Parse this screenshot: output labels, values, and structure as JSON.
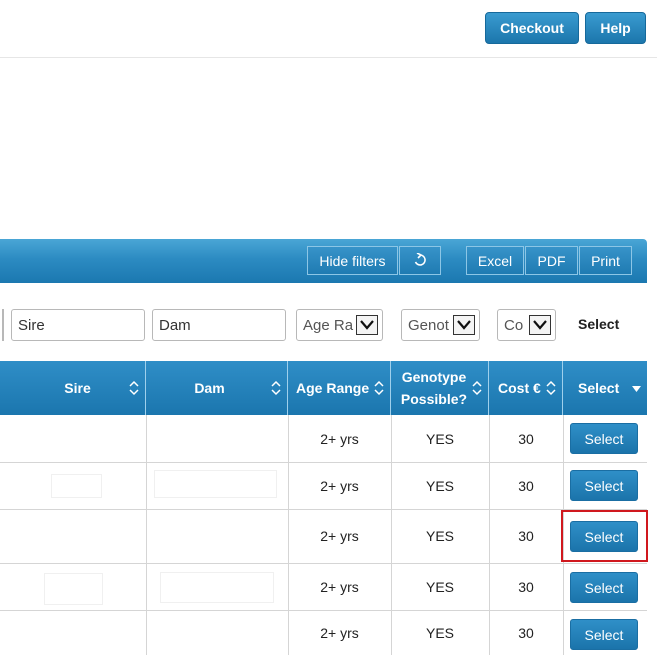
{
  "header": {
    "checkout_label": "Checkout",
    "help_label": "Help"
  },
  "toolbar": {
    "hide_filters_label": "Hide filters",
    "refresh_icon": "refresh-icon",
    "excel_label": "Excel",
    "pdf_label": "PDF",
    "print_label": "Print"
  },
  "filters": {
    "sire_value": "Sire",
    "dam_value": "Dam",
    "age_range_text": "Age Ra",
    "genotype_text": "Genot",
    "cost_text": "Co",
    "select_label": "Select"
  },
  "table": {
    "columns": [
      {
        "key": "sire",
        "label": "Sire"
      },
      {
        "key": "dam",
        "label": "Dam"
      },
      {
        "key": "age_range",
        "label": "Age Range"
      },
      {
        "key": "genotype",
        "label": "Genotype Possible?"
      },
      {
        "key": "cost",
        "label": "Cost €"
      },
      {
        "key": "select",
        "label": "Select"
      }
    ],
    "rows": [
      {
        "age_range": "2+ yrs",
        "genotype": "YES",
        "cost": "30",
        "select": "Select"
      },
      {
        "age_range": "2+ yrs",
        "genotype": "YES",
        "cost": "30",
        "select": "Select"
      },
      {
        "age_range": "2+ yrs",
        "genotype": "YES",
        "cost": "30",
        "select": "Select"
      },
      {
        "age_range": "2+ yrs",
        "genotype": "YES",
        "cost": "30",
        "select": "Select"
      },
      {
        "age_range": "2+ yrs",
        "genotype": "YES",
        "cost": "30",
        "select": "Select"
      }
    ]
  },
  "colors": {
    "brand_blue": "#1f7bb2",
    "highlight_red": "#d0181e"
  }
}
